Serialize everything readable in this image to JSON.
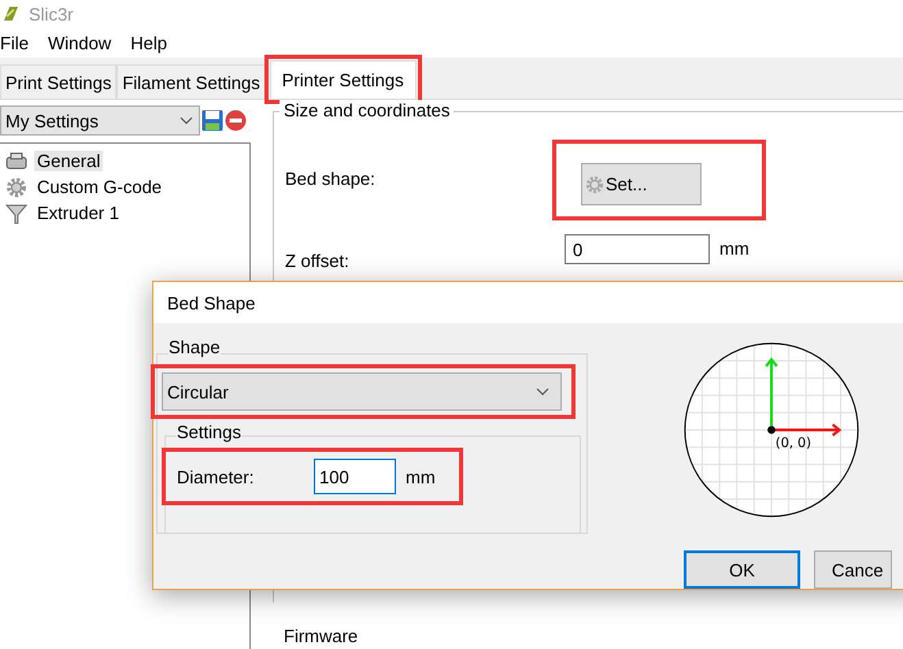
{
  "window": {
    "title": "Slic3r"
  },
  "menu": [
    "File",
    "Window",
    "Help"
  ],
  "tabs": [
    {
      "label": "Print Settings",
      "selected": false,
      "highlighted": false
    },
    {
      "label": "Filament Settings",
      "selected": false,
      "highlighted": false
    },
    {
      "label": "Printer Settings",
      "selected": true,
      "highlighted": true
    }
  ],
  "preset": {
    "value": "My Settings"
  },
  "sidebar": {
    "items": [
      {
        "label": "General",
        "kind": "printer",
        "selected": true
      },
      {
        "label": "Custom G-code",
        "kind": "gear",
        "selected": false
      },
      {
        "label": "Extruder 1",
        "kind": "funnel",
        "selected": false
      }
    ]
  },
  "section": {
    "title": "Size and coordinates",
    "bed_shape_label": "Bed shape:",
    "set_button": {
      "label": "Set...",
      "highlighted": true
    },
    "z_offset_label": "Z offset:",
    "z_offset_value": "0",
    "z_offset_unit": "mm"
  },
  "next_section": {
    "title": "Firmware"
  },
  "dialog": {
    "title": "Bed Shape",
    "shape_group": "Shape",
    "shape": {
      "value": "Circular",
      "highlighted": true
    },
    "settings_group": "Settings",
    "diameter": {
      "label": "Diameter:",
      "value": "100",
      "unit": "mm",
      "highlighted": true
    },
    "preview": {
      "origin_label": "(0, 0)"
    },
    "buttons": [
      {
        "label": "OK",
        "default": true
      },
      {
        "label": "Cance",
        "default": false
      }
    ]
  }
}
